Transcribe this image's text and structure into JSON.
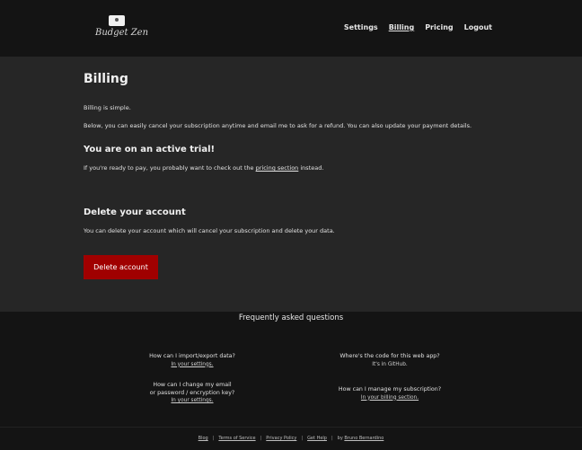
{
  "brand": {
    "name": "Budget Zen"
  },
  "nav": {
    "items": [
      {
        "label": "Settings"
      },
      {
        "label": "Billing"
      },
      {
        "label": "Pricing"
      },
      {
        "label": "Logout"
      }
    ],
    "active": "Billing"
  },
  "billing": {
    "title": "Billing",
    "intro": "Billing is simple.",
    "description": "Below, you can easily cancel your subscription anytime and email me to ask for a refund. You can also update your payment details.",
    "trial_heading": "You are on an active trial!",
    "trial_text_before": "If you're ready to pay, you probably want to check out the ",
    "trial_link": "pricing section",
    "trial_text_after": " instead.",
    "delete_heading": "Delete your account",
    "delete_text": "You can delete your account which will cancel your subscription and delete your data.",
    "delete_button": "Delete account"
  },
  "faq": {
    "title": "Frequently asked questions",
    "items": [
      {
        "question_lines": [
          "How can I import/export data?"
        ],
        "answer": "In your settings."
      },
      {
        "question_lines": [
          "Where's the code for this web app?"
        ],
        "answer": "It's in GitHub."
      },
      {
        "question_lines": [
          "How can I change my email",
          "or password / encryption key?"
        ],
        "answer": "In your settings."
      },
      {
        "question_lines": [
          "How can I manage my subscription?"
        ],
        "answer": "In your billing section."
      }
    ]
  },
  "footer": {
    "links": [
      "Blog",
      "Terms of Service",
      "Privacy Policy",
      "Get Help"
    ],
    "separator": "|",
    "by_text": "by",
    "author": "Bruno Bernardino"
  },
  "colors": {
    "header_bg": "#141414",
    "main_bg": "#262626",
    "danger": "#a00000"
  }
}
